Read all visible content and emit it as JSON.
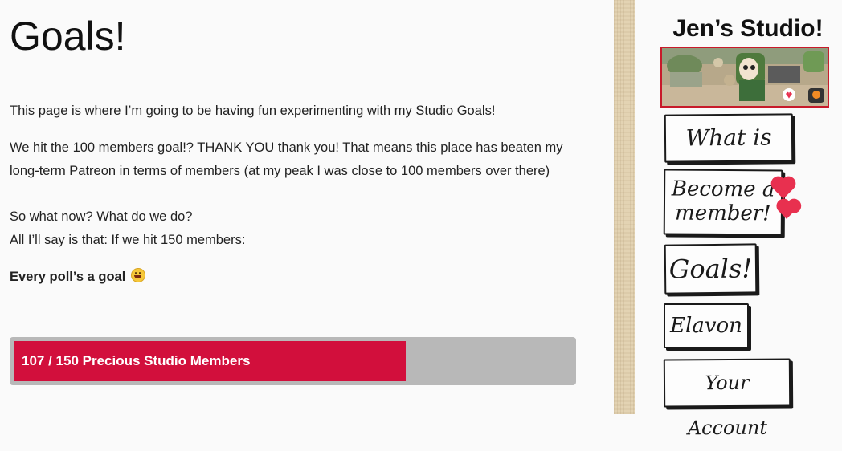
{
  "page": {
    "title": "Goals!",
    "paragraphs": [
      "This page is where I’m going to be having fun experimenting with my Studio Goals!",
      "We hit the 100 members goal!? THANK YOU thank you! That means this place has beaten my long-term Patreon in terms of members (at my peak I was close to 100 members over there)",
      "So what now? What do we do?",
      "All I’ll say is that: If we hit 150 members:"
    ],
    "goal_heading": "Every poll’s a goal",
    "goal_emoji": "grinning-face-icon"
  },
  "progress": {
    "label": "107 / 150 Precious Studio Members",
    "current": 107,
    "target": 150,
    "fill_color": "#d20f3c",
    "track_color": "#b8b8b8"
  },
  "sidebar": {
    "title": "Jen’s Studio!",
    "banner_icon": "studio-artwork-banner",
    "nav": [
      {
        "label": "What is this?"
      },
      {
        "label_line1": "Become a",
        "label_line2": "member!"
      },
      {
        "label": "Goals!"
      },
      {
        "label": "Elavon"
      },
      {
        "label": "Your Account"
      }
    ]
  },
  "colors": {
    "accent": "#d20f3c",
    "banner_border": "#c81a2a",
    "heart": "#e8304f"
  }
}
